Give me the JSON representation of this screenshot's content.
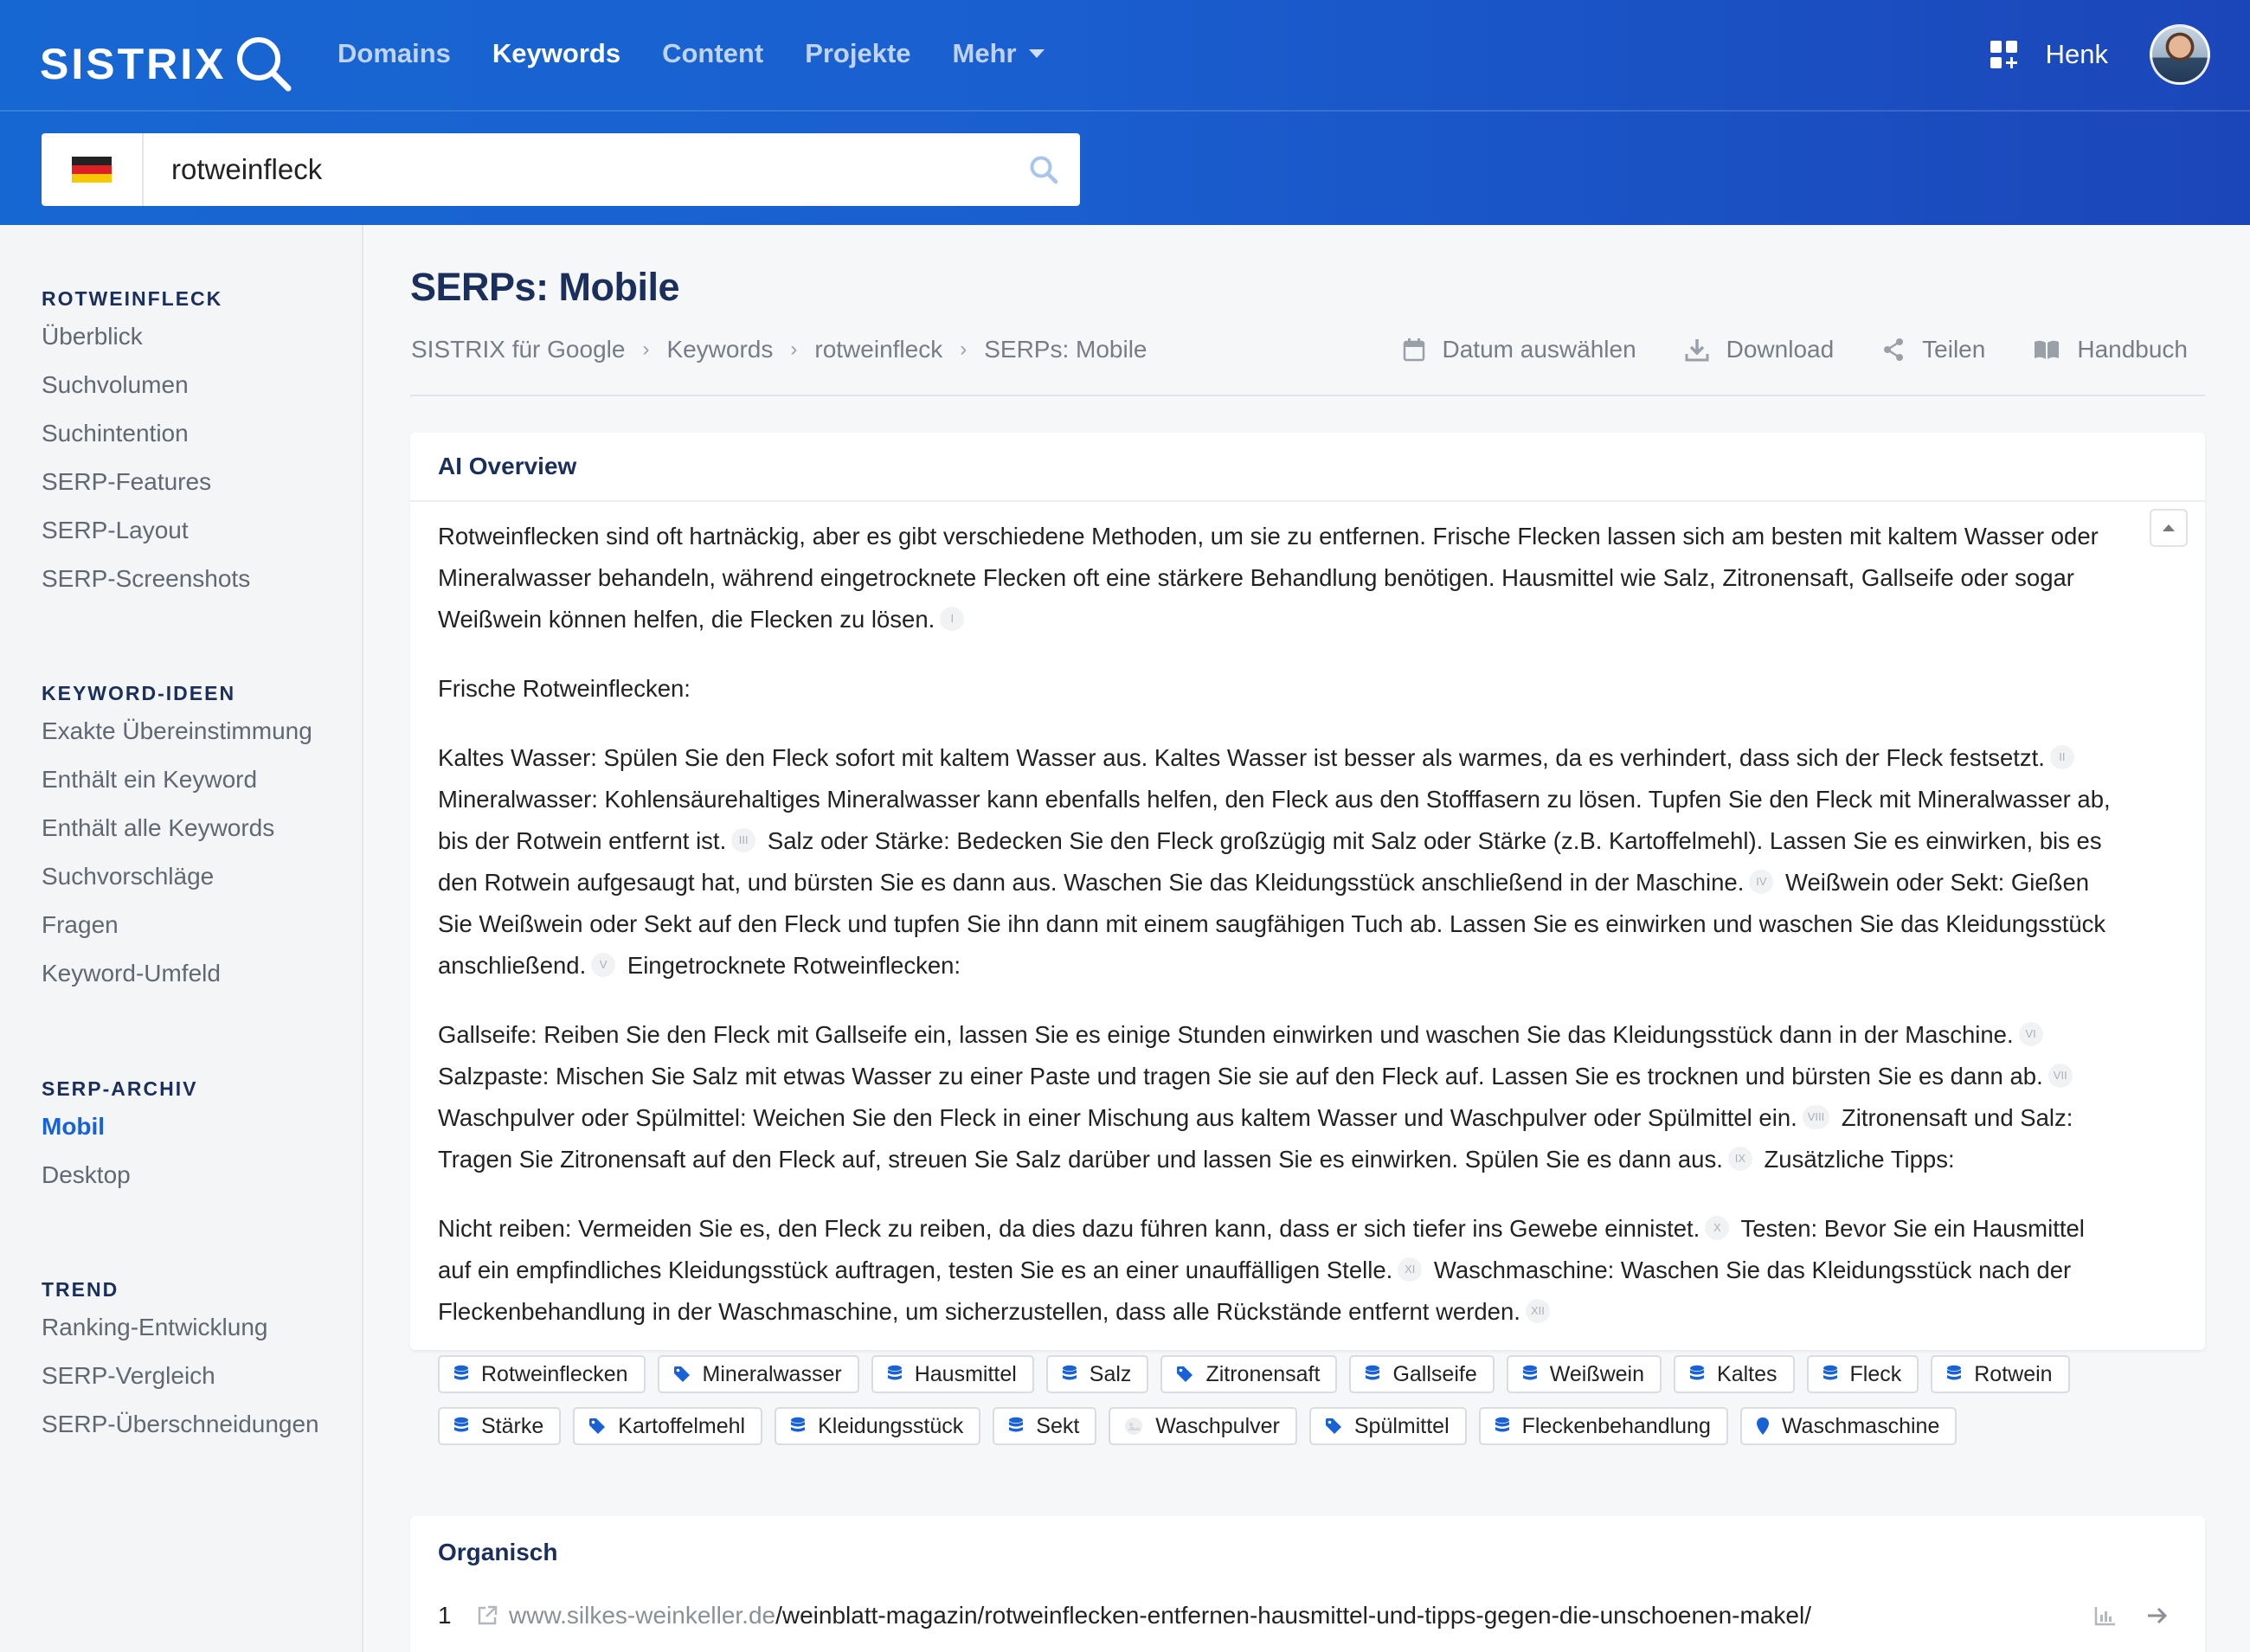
{
  "header": {
    "logo": "SISTRIX",
    "nav": [
      {
        "label": "Domains",
        "active": false
      },
      {
        "label": "Keywords",
        "active": true
      },
      {
        "label": "Content",
        "active": false
      },
      {
        "label": "Projekte",
        "active": false
      },
      {
        "label": "Mehr",
        "active": false
      }
    ],
    "user_name": "Henk"
  },
  "search": {
    "country_flag": "germany-flag-icon",
    "query": "rotweinfleck"
  },
  "sidebar": {
    "sections": [
      {
        "title": "ROTWEINFLECK",
        "items": [
          "Überblick",
          "Suchvolumen",
          "Suchintention",
          "SERP-Features",
          "SERP-Layout",
          "SERP-Screenshots"
        ]
      },
      {
        "title": "KEYWORD-IDEEN",
        "items": [
          "Exakte Übereinstimmung",
          "Enthält ein Keyword",
          "Enthält alle Keywords",
          "Suchvorschläge",
          "Fragen",
          "Keyword-Umfeld"
        ]
      },
      {
        "title": "SERP-ARCHIV",
        "items": [
          "Mobil",
          "Desktop"
        ],
        "active": "Mobil"
      },
      {
        "title": "TREND",
        "items": [
          "Ranking-Entwicklung",
          "SERP-Vergleich",
          "SERP-Überschneidungen"
        ]
      }
    ]
  },
  "page": {
    "title": "SERPs: Mobile",
    "breadcrumb": [
      "SISTRIX für Google",
      "Keywords",
      "rotweinfleck",
      "SERPs: Mobile"
    ],
    "actions": [
      "Datum auswählen",
      "Download",
      "Teilen",
      "Handbuch"
    ]
  },
  "ai_overview": {
    "heading": "AI Overview",
    "p1": "Rotweinflecken sind oft hartnäckig, aber es gibt verschiedene Methoden, um sie zu entfernen. Frische Flecken lassen sich am besten mit kaltem Wasser oder Mineralwasser behandeln, während eingetrocknete Flecken oft eine stärkere Behandlung benötigen. Hausmittel wie Salz, Zitronensaft, Gallseife oder sogar Weißwein können helfen, die Flecken zu lösen.",
    "p2": "Frische Rotweinflecken:",
    "p3a": "Kaltes Wasser: Spülen Sie den Fleck sofort mit kaltem Wasser aus. Kaltes Wasser ist besser als warmes, da es verhindert, dass sich der Fleck festsetzt.",
    "p3b": "Mineralwasser: Kohlensäurehaltiges Mineralwasser kann ebenfalls helfen, den Fleck aus den Stofffasern zu lösen. Tupfen Sie den Fleck mit Mineralwasser ab, bis der Rotwein entfernt ist.",
    "p3c": "Salz oder Stärke: Bedecken Sie den Fleck großzügig mit Salz oder Stärke (z.B. Kartoffelmehl). Lassen Sie es einwirken, bis es den Rotwein aufgesaugt hat, und bürsten Sie es dann aus. Waschen Sie das Kleidungsstück anschließend in der Maschine.",
    "p3d": "Weißwein oder Sekt: Gießen Sie Weißwein oder Sekt auf den Fleck und tupfen Sie ihn dann mit einem saugfähigen Tuch ab. Lassen Sie es einwirken und waschen Sie das Kleidungsstück anschließend.",
    "p3e": "Eingetrocknete Rotweinflecken:",
    "p4a": "Gallseife: Reiben Sie den Fleck mit Gallseife ein, lassen Sie es einige Stunden einwirken und waschen Sie das Kleidungsstück dann in der Maschine.",
    "p4b": "Salzpaste: Mischen Sie Salz mit etwas Wasser zu einer Paste und tragen Sie sie auf den Fleck auf. Lassen Sie es trocknen und bürsten Sie es dann ab.",
    "p4c": "Waschpulver oder Spülmittel: Weichen Sie den Fleck in einer Mischung aus kaltem Wasser und Waschpulver oder Spülmittel ein.",
    "p4d": "Zitronensaft und Salz: Tragen Sie Zitronensaft auf den Fleck auf, streuen Sie Salz darüber und lassen Sie es einwirken. Spülen Sie es dann aus.",
    "p4e": "Zusätzliche Tipps:",
    "p5a": "Nicht reiben: Vermeiden Sie es, den Fleck zu reiben, da dies dazu führen kann, dass er sich tiefer ins Gewebe einnistet.",
    "p5b": "Testen: Bevor Sie ein Hausmittel auf ein empfindliches Kleidungsstück auftragen, testen Sie es an einer unauffälligen Stelle.",
    "p5c": "Waschmaschine: Waschen Sie das Kleidungsstück nach der Fleckenbehandlung in der Waschmaschine, um sicherzustellen, dass alle Rückstände entfernt werden.",
    "citations": [
      "I",
      "II",
      "III",
      "IV",
      "V",
      "VI",
      "VII",
      "VIII",
      "IX",
      "X",
      "XI",
      "XII"
    ],
    "tags": [
      {
        "label": "Rotweinflecken",
        "icon": "database-icon"
      },
      {
        "label": "Mineralwasser",
        "icon": "tag-icon"
      },
      {
        "label": "Hausmittel",
        "icon": "database-icon"
      },
      {
        "label": "Salz",
        "icon": "database-icon"
      },
      {
        "label": "Zitronensaft",
        "icon": "tag-icon"
      },
      {
        "label": "Gallseife",
        "icon": "database-icon"
      },
      {
        "label": "Weißwein",
        "icon": "database-icon"
      },
      {
        "label": "Kaltes",
        "icon": "database-icon"
      },
      {
        "label": "Fleck",
        "icon": "database-icon"
      },
      {
        "label": "Rotwein",
        "icon": "database-icon"
      },
      {
        "label": "Stärke",
        "icon": "database-icon"
      },
      {
        "label": "Kartoffelmehl",
        "icon": "tag-icon"
      },
      {
        "label": "Kleidungsstück",
        "icon": "database-icon"
      },
      {
        "label": "Sekt",
        "icon": "database-icon"
      },
      {
        "label": "Waschpulver",
        "icon": "image-placeholder-icon"
      },
      {
        "label": "Spülmittel",
        "icon": "tag-icon"
      },
      {
        "label": "Fleckenbehandlung",
        "icon": "database-icon"
      },
      {
        "label": "Waschmaschine",
        "icon": "location-pin-icon"
      }
    ]
  },
  "organic": {
    "heading": "Organisch",
    "rows": [
      {
        "rank": "1",
        "domain": "www.silkes-weinkeller.de",
        "path": "/weinblatt-magazin/rotweinflecken-entfernen-hausmittel-und-tipps-gegen-die-unschoenen-makel/"
      }
    ]
  },
  "colors": {
    "brand_blue": "#1767d2",
    "accent": "#1862d6",
    "title_navy": "#1b2f5c"
  }
}
